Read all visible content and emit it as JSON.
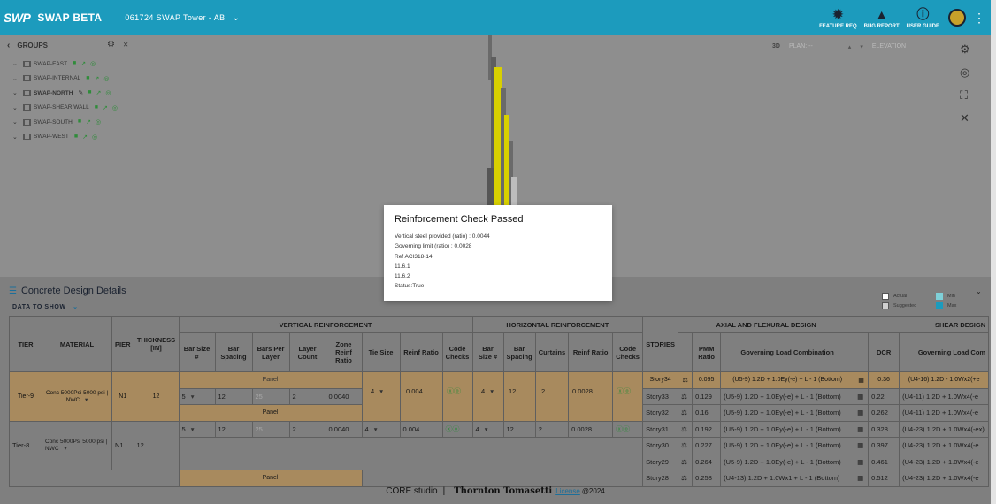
{
  "app": {
    "logo": "SWP",
    "name": "SWAP BETA",
    "project": "061724 SWAP Tower - AB"
  },
  "topbar": [
    {
      "label": "FEATURE REQ",
      "icon": "lightbulb-icon"
    },
    {
      "label": "BUG REPORT",
      "icon": "warning-icon"
    },
    {
      "label": "USER GUIDE",
      "icon": "info-icon"
    }
  ],
  "groups": {
    "title": "GROUPS",
    "items": [
      {
        "name": "SWAP-EAST",
        "bold": false
      },
      {
        "name": "SWAP-INTERNAL",
        "bold": false
      },
      {
        "name": "SWAP-NORTH",
        "bold": true
      },
      {
        "name": "SWAP-SHEAR WALL",
        "bold": false
      },
      {
        "name": "SWAP-SOUTH",
        "bold": false
      },
      {
        "name": "SWAP-WEST",
        "bold": false
      }
    ]
  },
  "viewport": {
    "mode_3d": "3D",
    "plan": "PLAN: --",
    "elevation": "ELEVATION"
  },
  "modal": {
    "title": "Reinforcement Check Passed",
    "lines": [
      "Vertical steel provided (ratio) : 0.0044",
      "Governing limit (ratio) : 0.0028",
      "Ref ACI318-14",
      "11.6.1",
      "11.6.2",
      "Status:True"
    ]
  },
  "panel": {
    "title": "Concrete Design Details",
    "data_to_show": "DATA TO SHOW",
    "legend": {
      "actual": "Actual",
      "suggested": "Suggested",
      "min": "Min",
      "max": "Max"
    }
  },
  "table": {
    "headers": {
      "tier": "TIER",
      "material": "MATERIAL",
      "pier": "PIER",
      "thickness": "THICKNESS [IN]",
      "vertical": "VERTICAL REINFORCEMENT",
      "horizontal": "HORIZONTAL REINFORCEMENT",
      "stories": "STORIES",
      "axial": "AXIAL AND FLEXURAL DESIGN",
      "shear": "SHEAR DESIGN",
      "bar_size": "Bar Size #",
      "bar_spacing": "Bar Spacing",
      "bars_per_layer": "Bars Per Layer",
      "layer_count": "Layer Count",
      "zone_reinf_ratio": "Zone Reinf Ratio",
      "tie_size": "Tie Size",
      "reinf_ratio": "Reinf Ratio",
      "code_checks": "Code Checks",
      "curtains": "Curtains",
      "pmm_ratio": "PMM Ratio",
      "gov_load_combo": "Governing Load Combination",
      "dcr": "DCR",
      "shear_gov_load": "Governing Load Com"
    },
    "panel_label": "Panel",
    "tiers": [
      {
        "tier": "Tier-9",
        "material": "Conc 5000Psi 5000 psi | NWC",
        "pier": "N1",
        "thickness": "12",
        "v_bar_size": "5",
        "v_bar_spacing": "12",
        "bars_per_layer": "25",
        "layer_count": "2",
        "zone_ratio": "0.0040",
        "tie_size": "4",
        "v_reinf_ratio": "0.004",
        "h_bar_size": "4",
        "h_bar_spacing": "12",
        "curtains": "2",
        "h_reinf_ratio": "0.0028"
      },
      {
        "tier": "Tier-8",
        "material": "Conc 5000Psi 5000 psi | NWC",
        "pier": "N1",
        "thickness": "12",
        "v_bar_size": "5",
        "v_bar_spacing": "12",
        "bars_per_layer": "25",
        "layer_count": "2",
        "zone_ratio": "0.0040",
        "tie_size": "4",
        "v_reinf_ratio": "0.004",
        "h_bar_size": "4",
        "h_bar_spacing": "12",
        "curtains": "2",
        "h_reinf_ratio": "0.0028"
      }
    ],
    "stories": [
      {
        "story": "Story34",
        "pmm": "0.095",
        "combo": "(U5-9) 1.2D + 1.0Ey(-e) + L - 1 (Bottom)",
        "dcr": "0.36",
        "shear_combo": "(U4-16) 1.2D - 1.0Wx2(+e"
      },
      {
        "story": "Story33",
        "pmm": "0.129",
        "combo": "(U5-9) 1.2D + 1.0Ey(-e) + L - 1 (Bottom)",
        "dcr": "0.22",
        "shear_combo": "(U4-11) 1.2D + 1.0Wx4(-e"
      },
      {
        "story": "Story32",
        "pmm": "0.16",
        "combo": "(U5-9) 1.2D + 1.0Ey(-e) + L - 1 (Bottom)",
        "dcr": "0.262",
        "shear_combo": "(U4-11) 1.2D + 1.0Wx4(-e"
      },
      {
        "story": "Story31",
        "pmm": "0.192",
        "combo": "(U5-9) 1.2D + 1.0Ey(-e) + L - 1 (Bottom)",
        "dcr": "0.328",
        "shear_combo": "(U4-23) 1.2D + 1.0Wx4(-ex)"
      },
      {
        "story": "Story30",
        "pmm": "0.227",
        "combo": "(U5-9) 1.2D + 1.0Ey(-e) + L - 1 (Bottom)",
        "dcr": "0.397",
        "shear_combo": "(U4-23) 1.2D + 1.0Wx4(-e"
      },
      {
        "story": "Story29",
        "pmm": "0.264",
        "combo": "(U5-9) 1.2D + 1.0Ey(-e) + L - 1 (Bottom)",
        "dcr": "0.461",
        "shear_combo": "(U4-23) 1.2D + 1.0Wx4(-e"
      },
      {
        "story": "Story28",
        "pmm": "0.258",
        "combo": "(U4-13) 1.2D + 1.0Wx1 + L - 1 (Bottom)",
        "dcr": "0.512",
        "shear_combo": "(U4-23) 1.2D + 1.0Wx4(-e"
      }
    ]
  },
  "footer": {
    "studio": "CORE studio",
    "sep": "|",
    "company": "Thornton Tomasetti",
    "license": "License",
    "year": "@2024"
  },
  "colors": {
    "topbar": "#1c9bbd",
    "panel_row": "#a88a5e",
    "check_green": "#2f8c3a"
  }
}
